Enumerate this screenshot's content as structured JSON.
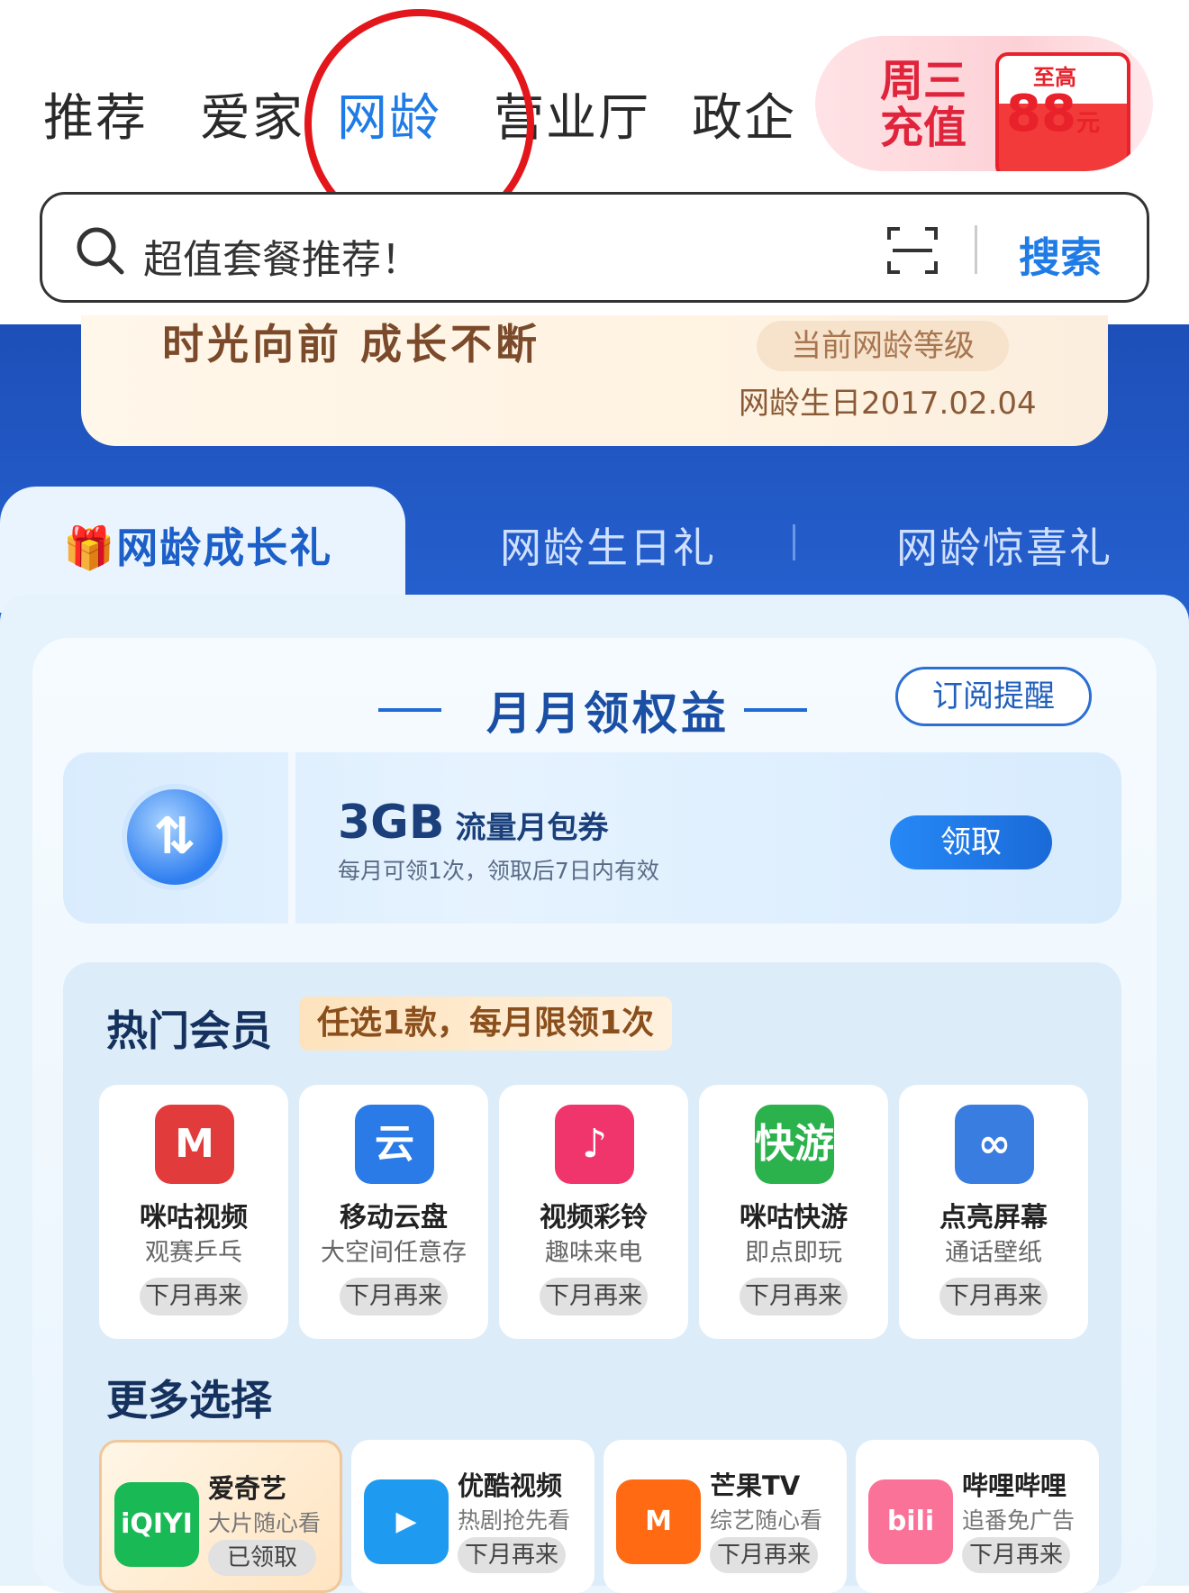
{
  "nav": {
    "tabs": [
      "推荐",
      "爱家",
      "网龄",
      "营业厅",
      "政企"
    ],
    "active_index": 2
  },
  "promo": {
    "line1": "周三",
    "line2": "充值",
    "small": "至高",
    "amount": "88",
    "unit": "元"
  },
  "search": {
    "placeholder": "超值套餐推荐！",
    "button": "搜索"
  },
  "birthday": {
    "slogan": "时光向前 成长不断",
    "level": "当前网龄等级",
    "date": "网龄生日2017.02.04"
  },
  "gift_tabs": [
    "网龄成长礼",
    "网龄生日礼",
    "网龄惊喜礼"
  ],
  "monthly": {
    "title": "月月领权益",
    "subscribe": "订阅提醒"
  },
  "flow": {
    "amount": "3GB",
    "name": "流量月包券",
    "desc": "每月可领1次，领取后7日内有效",
    "button": "领取"
  },
  "hot": {
    "title": "热门会员",
    "badge": "任选1款，每月限领1次",
    "items": [
      {
        "name": "咪咕视频",
        "sub": "观赛乒乓",
        "status": "下月再来",
        "icon": "migu-video-icon",
        "color": "#e23b3b",
        "glyph": "M"
      },
      {
        "name": "移动云盘",
        "sub": "大空间任意存",
        "status": "下月再来",
        "icon": "cloud-drive-icon",
        "color": "#2a7be8",
        "glyph": "云"
      },
      {
        "name": "视频彩铃",
        "sub": "趣味来电",
        "status": "下月再来",
        "icon": "video-ringtone-icon",
        "color": "#f0356c",
        "glyph": "♪"
      },
      {
        "name": "咪咕快游",
        "sub": "即点即玩",
        "status": "下月再来",
        "icon": "migu-game-icon",
        "color": "#2bb24c",
        "glyph": "快游"
      },
      {
        "name": "点亮屏幕",
        "sub": "通话壁纸",
        "status": "下月再来",
        "icon": "new-call-icon",
        "color": "#3a7de0",
        "glyph": "∞"
      }
    ]
  },
  "more": {
    "title": "更多选择",
    "items": [
      {
        "name": "爱奇艺",
        "sub": "大片随心看",
        "status": "已领取",
        "icon": "iqiyi-icon",
        "color": "#19b955",
        "glyph": "iQIYI",
        "selected": true
      },
      {
        "name": "优酷视频",
        "sub": "热剧抢先看",
        "status": "下月再来",
        "icon": "youku-icon",
        "color": "#1e9bf0",
        "glyph": "▶",
        "selected": false
      },
      {
        "name": "芒果TV",
        "sub": "综艺随心看",
        "status": "下月再来",
        "icon": "mango-tv-icon",
        "color": "#ff6a13",
        "glyph": "M",
        "selected": false
      },
      {
        "name": "哔哩哔哩",
        "sub": "追番免广告",
        "status": "下月再来",
        "icon": "bilibili-icon",
        "color": "#fb7299",
        "glyph": "bili",
        "selected": false
      }
    ]
  }
}
